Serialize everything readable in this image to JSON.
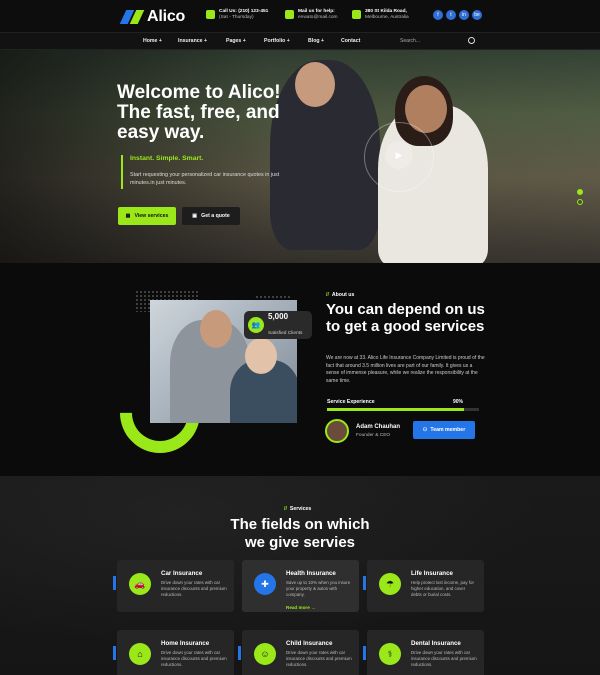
{
  "brand": {
    "name": "Alico",
    "accent": "#9be81a",
    "blue": "#2476e8"
  },
  "topbar": {
    "call": {
      "title": "Call Us: (210) 123-451",
      "sub": "(Sat - Thursday)"
    },
    "mail": {
      "title": "Mail us for help:",
      "sub": "enwato@mail.com"
    },
    "address": {
      "title": "380 St Kilda Road,",
      "sub": "Melbourne, Australia"
    },
    "socials": [
      "f",
      "t",
      "in",
      "be"
    ]
  },
  "nav": {
    "items": [
      "Home +",
      "Insurance +",
      "Pages +",
      "Portfolio +",
      "Blog +",
      "Contact"
    ],
    "search_placeholder": "Search..."
  },
  "hero": {
    "title": "Welcome to Alico! The fast, free, and easy way.",
    "tagline": "Instant. Simple. Smart.",
    "description": "Start requesting your personalized car insurance quotes in just minutes.in just minutes.",
    "primary_button": "View services",
    "secondary_button": "Get a quote",
    "play_icon": "▶"
  },
  "about": {
    "stat_value": "5,000",
    "stat_label": "Satisfied Clients",
    "eyebrow": "About us",
    "title": "You can depend on us to get a good services",
    "description": "We are now at 33. Alico Life Insurance Company Limited is proud of the fact that around 3.5 million lives are part of our family. It gives us a sense of immense pleasure, while we realize the responsibility at the same time.",
    "progress_label": "Service Experience",
    "progress_value": "90%",
    "progress_fraction": 0.9,
    "person_name": "Adam Chauhan",
    "person_role": "Founder & CEO",
    "team_button": "Team member"
  },
  "services": {
    "eyebrow": "Services",
    "title_line1": "The fields on which",
    "title_line2": "we give servies",
    "read_more": "Read more →",
    "cards": [
      {
        "title": "Car Insurance",
        "desc": "Drive down your rates with car insurance discounts and premium reductions.",
        "icon": "car-icon"
      },
      {
        "title": "Health Insurance",
        "desc": "Save up to 10% when you insure your property & autos with company.",
        "icon": "heart-hand-icon"
      },
      {
        "title": "Life Insurance",
        "desc": "Help protect lost income, pay for higher education, and cover debts or burial costs.",
        "icon": "umbrella-icon"
      },
      {
        "title": "Home Insurance",
        "desc": "Drive down your rates with car insurance discounts and premium reductions.",
        "icon": "home-icon"
      },
      {
        "title": "Child Insurance",
        "desc": "Drive down your rates with car insurance discounts and premium reductions.",
        "icon": "child-icon"
      },
      {
        "title": "Dental Insurance",
        "desc": "Drive down your rates with car insurance discounts and premium reductions.",
        "icon": "tooth-icon"
      }
    ]
  }
}
